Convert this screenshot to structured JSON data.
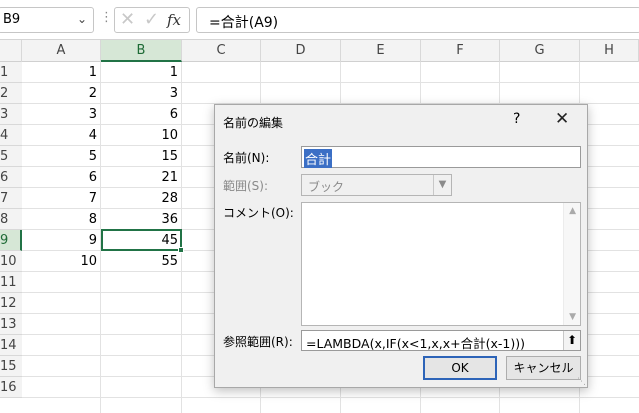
{
  "formula_bar": {
    "name_box": "B9",
    "formula": "=合計(A9)"
  },
  "grid": {
    "columns": [
      "A",
      "B",
      "C",
      "D",
      "E",
      "F",
      "G",
      "H"
    ],
    "rows": [
      "1",
      "2",
      "3",
      "4",
      "5",
      "6",
      "7",
      "8",
      "9",
      "10",
      "11",
      "12",
      "13",
      "14",
      "15",
      "16"
    ],
    "col_a": [
      "1",
      "2",
      "3",
      "4",
      "5",
      "6",
      "7",
      "8",
      "9",
      "10"
    ],
    "col_b": [
      "1",
      "3",
      "6",
      "10",
      "15",
      "21",
      "28",
      "36",
      "45",
      "55"
    ]
  },
  "dialog": {
    "title": "名前の編集",
    "help": "?",
    "name_label": "名前(N):",
    "name_value": "合計",
    "scope_label": "範囲(S):",
    "scope_value": "ブック",
    "comment_label": "コメント(O):",
    "refers_label": "参照範囲(R):",
    "refers_value": "=LAMBDA(x,IF(x<1,x,x+合計(x-1)))",
    "ok_label": "OK",
    "cancel_label": "キャンセル"
  },
  "colors": {
    "accent": "#217346",
    "selected_header": "#d6e7d6",
    "focus_blue": "#2d64b8"
  }
}
